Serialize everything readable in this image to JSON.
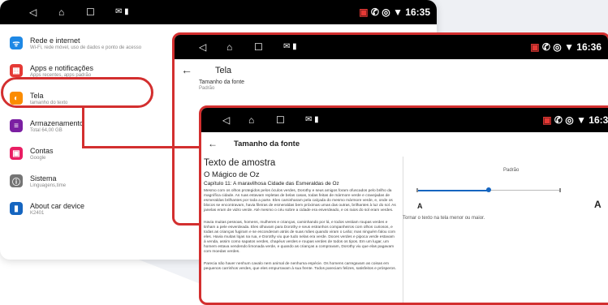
{
  "screen1": {
    "time": "16:35",
    "items": [
      {
        "icon": "wifi-icon",
        "color": "#1e88e5",
        "title": "Rede e internet",
        "subtitle": "Wi-Fi, rede móvel, uso de dados e ponto de acesso"
      },
      {
        "icon": "apps-icon",
        "color": "#e53935",
        "title": "Apps e notificações",
        "subtitle": "Apps recentes, apps padrão"
      },
      {
        "icon": "display-icon",
        "color": "#fb8c00",
        "title": "Tela",
        "subtitle": "tamanho do texto"
      },
      {
        "icon": "storage-icon",
        "color": "#7b1fa2",
        "title": "Armazenamento",
        "subtitle": "Total 64,00 GB"
      },
      {
        "icon": "accounts-icon",
        "color": "#e91e63",
        "title": "Contas",
        "subtitle": "Google"
      },
      {
        "icon": "system-icon",
        "color": "#757575",
        "title": "Sistema",
        "subtitle": "Linguagens,time"
      },
      {
        "icon": "about-icon",
        "color": "#1565c0",
        "title": "About car device",
        "subtitle": "K2401"
      }
    ]
  },
  "screen2": {
    "time": "16:36",
    "title": "Tela",
    "row_title": "Tamanho da fonte",
    "row_sub": "Padrão"
  },
  "screen3": {
    "time": "16:36",
    "title": "Tamanho da fonte",
    "preview_title": "Texto de amostra",
    "preview_book": "O Mágico de Oz",
    "preview_chapter": "Capítulo 11: A maravilhosa Cidade das Esmeraldas de Oz",
    "para1": "Mesmo com os olhos protegidos pelos óculos verdes, Dorothy e seus amigos foram ofuscados pelo brilho da magnífica cidade. As ruas estavam repletas de belas casas, todas feitas de mármore verde e cravejadas de esmeraldas brilhantes por toda a parte. Eles caminharam pela calçada do mesmo mármore verde, e, onde os blocos se encontravam, havia fileiras de esmeraldas bem próximas umas das outras, brilhantes à luz do sol. As janelas eram de vidro verde. Até mesmo o céu sobre a cidade era esverdeado, e os raios do sol eram verdes.",
    "para2": "Havia muitas pessoas, homens, mulheres e crianças, caminhando por lá, e todos vestiam roupas verdes e tinham a pele esverdeada. Eles olhavam para Dorothy e seus estranhos companheiros com olhos curiosos, e todas as crianças fugiram e se esconderam atrás de suas mães quando viram o Leão; mas ninguém falou com eles. Havia muitas lojas na rua, e Dorothy viu que tudo nelas era verde. Doces verdes e pipoca verde estavam à venda, assim como sapatos verdes, chapéus verdes e roupas verdes de todos os tipos. Em um lugar, um homem estava vendendo limonada verde, e quando as crianças a compravam, Dorothy viu que elas pagavam com moedas verdes.",
    "para3": "Parecia não haver nenhum cavalo nem animal de nenhuma espécie. Os homens carregavam as coisas em pequenos carrinhos verdes, que eles empurravam à sua frente. Todos pareciam felizes, satisfeitos e prósperos.",
    "slider_label": "Padrão",
    "slider_value": 0.5,
    "small_a": "A",
    "big_a": "A",
    "hint": "Tornar o texto na tela menor ou maior."
  }
}
